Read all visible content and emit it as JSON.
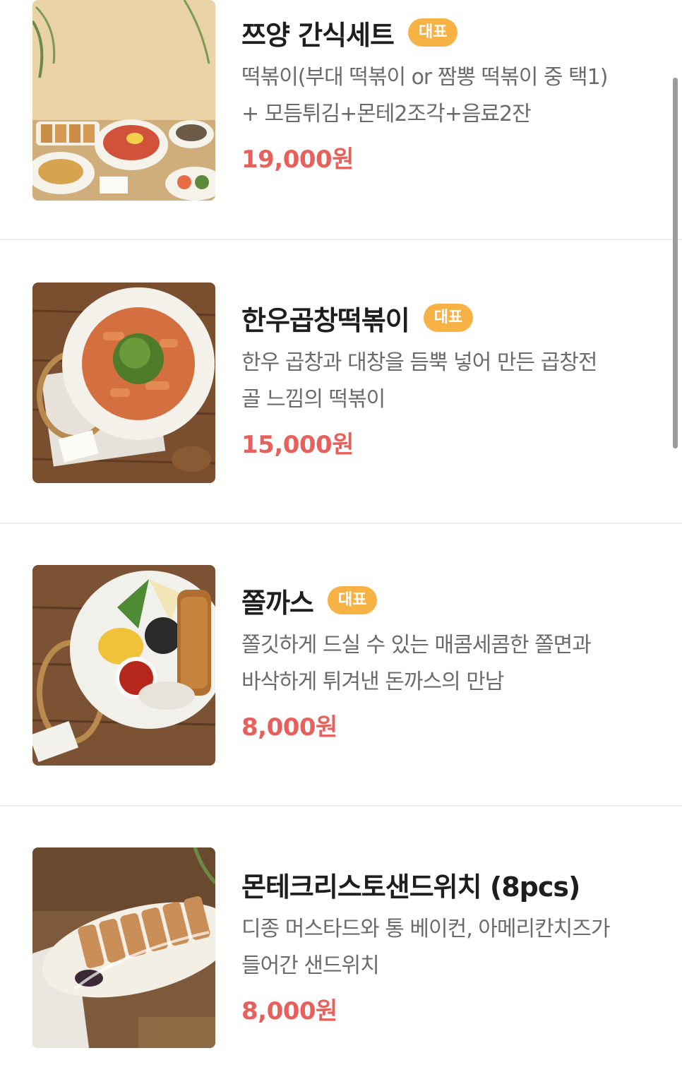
{
  "menu": {
    "items": [
      {
        "title": "쯔양 간식세트",
        "badge": "대표",
        "desc_line1": "떡볶이(부대 떡볶이 or 짬뽕 떡볶이 중 택1)",
        "desc_line2": "+ 모듬튀김+몬테2조각+음료2잔",
        "price": "19,000원"
      },
      {
        "title": "한우곱창떡볶이",
        "badge": "대표",
        "desc_line1": "한우 곱창과 대창을 듬뿍 넣어 만든 곱창전",
        "desc_line2": "골 느낌의 떡볶이",
        "price": "15,000원"
      },
      {
        "title": "쫄까스",
        "badge": "대표",
        "desc_line1": "쫄깃하게 드실 수 있는 매콤세콤한 쫄면과",
        "desc_line2": "바삭하게 튀겨낸 돈까스의 만남",
        "price": "8,000원"
      },
      {
        "title": "몬테크리스토샌드위치 (8pcs)",
        "badge": "",
        "desc_line1": "디종 머스타드와 통 베이컨, 아메리칸치즈가",
        "desc_line2": "들어간 샌드위치",
        "price": "8,000원"
      }
    ]
  },
  "colors": {
    "badge": "#f7b246",
    "price": "#e8605b",
    "title": "#1e1e1e",
    "desc": "#6b6b6b"
  }
}
